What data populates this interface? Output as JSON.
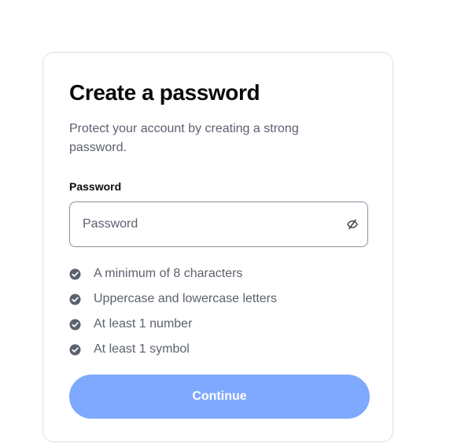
{
  "card": {
    "title": "Create a password",
    "subtitle": "Protect your account by creating a strong password."
  },
  "password_field": {
    "label": "Password",
    "placeholder": "Password",
    "value": "",
    "toggle_icon": "eye-slash-icon"
  },
  "requirements": [
    {
      "text": "A minimum of 8 characters",
      "icon": "check-circle-icon"
    },
    {
      "text": "Uppercase and lowercase letters",
      "icon": "check-circle-icon"
    },
    {
      "text": "At least 1 number",
      "icon": "check-circle-icon"
    },
    {
      "text": "At least 1 symbol",
      "icon": "check-circle-icon"
    }
  ],
  "continue_button": {
    "label": "Continue",
    "enabled": false
  },
  "colors": {
    "primary_disabled": "#7fa9ff",
    "text_primary": "#0a0b0d",
    "text_secondary": "#5b616e",
    "check_icon": "#5b616e",
    "card_border": "#dcdfe4",
    "input_border": "#8a919e"
  }
}
